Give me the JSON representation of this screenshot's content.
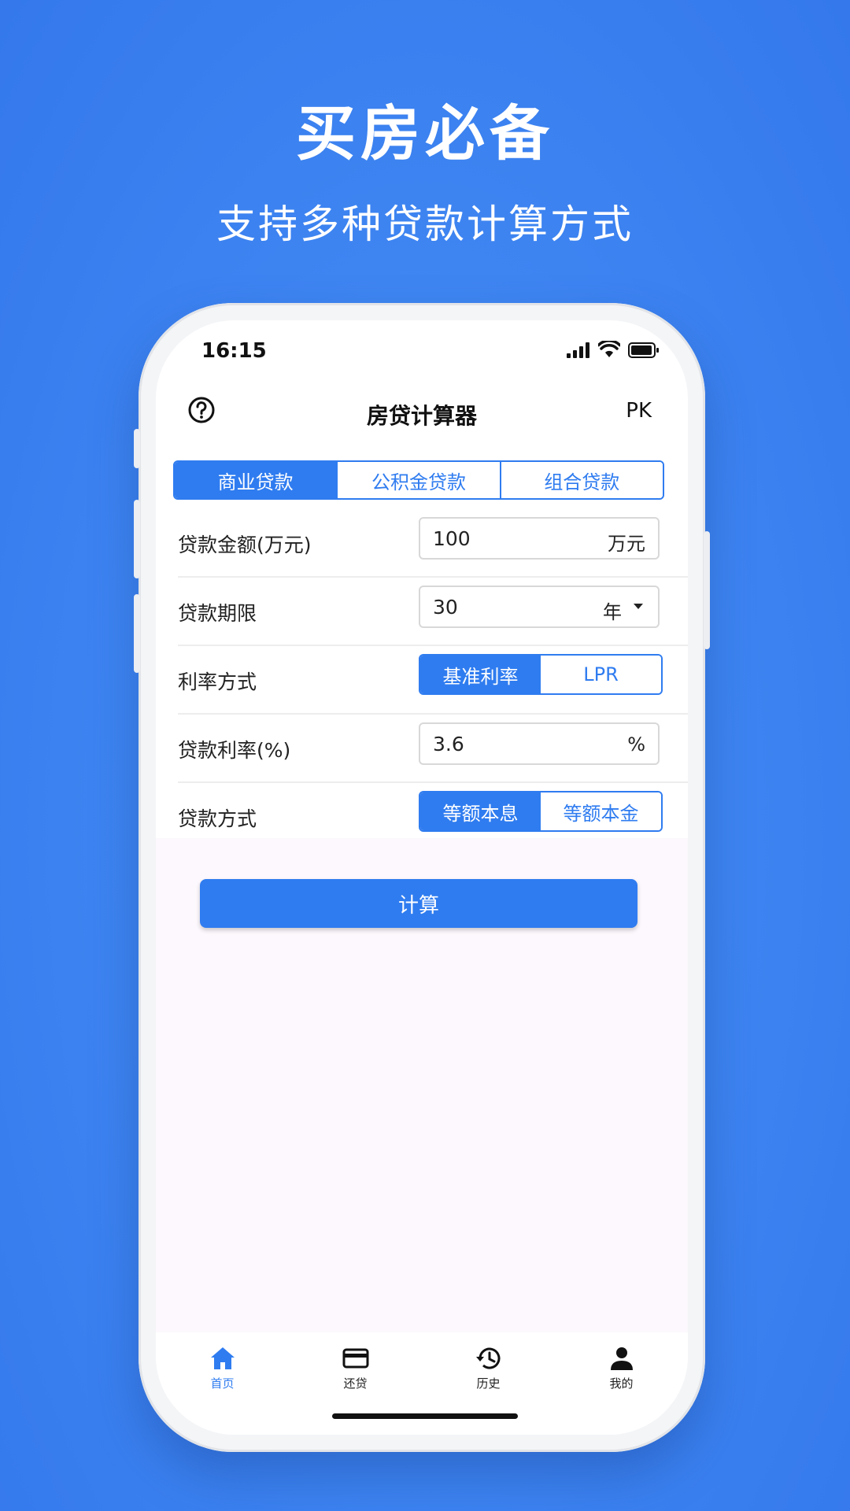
{
  "promo": {
    "headline": "买房必备",
    "subline": "支持多种贷款计算方式"
  },
  "status": {
    "time": "16:15"
  },
  "nav": {
    "title": "房贷计算器",
    "right_label": "PK",
    "help_icon": "question-circle-icon"
  },
  "tabs": [
    {
      "label": "商业贷款",
      "active": true
    },
    {
      "label": "公积金贷款",
      "active": false
    },
    {
      "label": "组合贷款",
      "active": false
    }
  ],
  "form": {
    "amount": {
      "label": "贷款金额(万元)",
      "value": "100",
      "unit": "万元"
    },
    "term": {
      "label": "贷款期限",
      "value": "30",
      "unit": "年"
    },
    "rate_mode": {
      "label": "利率方式",
      "options": [
        "基准利率",
        "LPR"
      ],
      "selected": "基准利率"
    },
    "rate": {
      "label": "贷款利率(%)",
      "value": "3.6",
      "unit": "%"
    },
    "method": {
      "label": "贷款方式",
      "options": [
        "等额本息",
        "等额本金"
      ],
      "selected": "等额本息"
    }
  },
  "calculate_label": "计算",
  "tabbar": [
    {
      "label": "首页",
      "icon": "home-icon",
      "active": true
    },
    {
      "label": "还贷",
      "icon": "card-icon",
      "active": false
    },
    {
      "label": "历史",
      "icon": "history-icon",
      "active": false
    },
    {
      "label": "我的",
      "icon": "person-icon",
      "active": false
    }
  ],
  "colors": {
    "accent": "#2f7cf0",
    "background": "#3f86f2"
  }
}
